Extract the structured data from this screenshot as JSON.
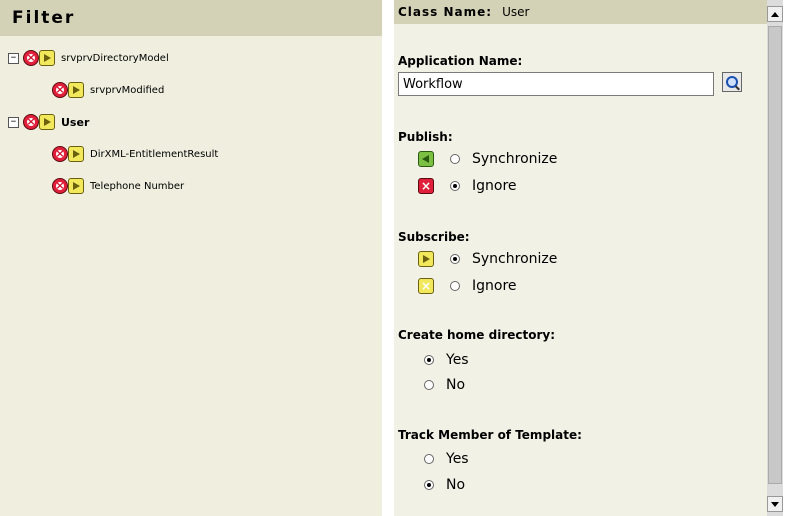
{
  "filter": {
    "title": "Filter",
    "tree": [
      {
        "label": "srvprvDirectoryModel",
        "bold": false
      },
      {
        "label": "srvprvModified",
        "bold": false
      },
      {
        "label": "User",
        "bold": true
      },
      {
        "label": "DirXML-EntitlementResult",
        "bold": false
      },
      {
        "label": "Telephone Number",
        "bold": false
      }
    ]
  },
  "detail": {
    "class_name_label": "Class Name:",
    "class_name_value": "User",
    "application_name_label": "Application Name:",
    "application_name_value": "Workflow",
    "publish_label": "Publish:",
    "publish_options": [
      {
        "label": "Synchronize",
        "selected": false
      },
      {
        "label": "Ignore",
        "selected": true
      }
    ],
    "subscribe_label": "Subscribe:",
    "subscribe_options": [
      {
        "label": "Synchronize",
        "selected": true
      },
      {
        "label": "Ignore",
        "selected": false
      }
    ],
    "home_dir_label": "Create home directory:",
    "home_dir_options": [
      {
        "label": "Yes",
        "selected": true
      },
      {
        "label": "No",
        "selected": false
      }
    ],
    "track_label": "Track Member of Template:",
    "track_options": [
      {
        "label": "Yes",
        "selected": false
      },
      {
        "label": "No",
        "selected": true
      }
    ]
  },
  "colors": {
    "header_bg": "#d4d2b6",
    "panel_bg": "#efeedf"
  }
}
